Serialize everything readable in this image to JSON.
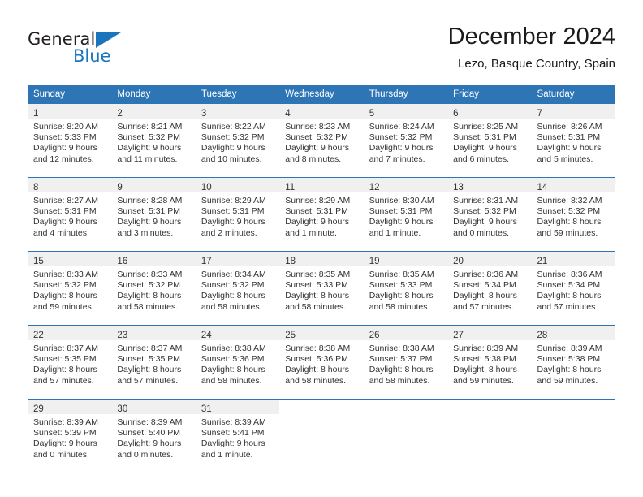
{
  "logo": {
    "word_one": "General",
    "word_two": "Blue"
  },
  "header": {
    "title": "December 2024",
    "subtitle": "Lezo, Basque Country, Spain"
  },
  "weekdays": [
    "Sunday",
    "Monday",
    "Tuesday",
    "Wednesday",
    "Thursday",
    "Friday",
    "Saturday"
  ],
  "colors": {
    "header_blue": "#2e75b6",
    "day_band_gray": "#f0f0f0",
    "logo_blue": "#1b75bc",
    "text": "#333333"
  },
  "weeks": [
    [
      {
        "num": "1",
        "l1": "Sunrise: 8:20 AM",
        "l2": "Sunset: 5:33 PM",
        "l3": "Daylight: 9 hours",
        "l4": "and 12 minutes."
      },
      {
        "num": "2",
        "l1": "Sunrise: 8:21 AM",
        "l2": "Sunset: 5:32 PM",
        "l3": "Daylight: 9 hours",
        "l4": "and 11 minutes."
      },
      {
        "num": "3",
        "l1": "Sunrise: 8:22 AM",
        "l2": "Sunset: 5:32 PM",
        "l3": "Daylight: 9 hours",
        "l4": "and 10 minutes."
      },
      {
        "num": "4",
        "l1": "Sunrise: 8:23 AM",
        "l2": "Sunset: 5:32 PM",
        "l3": "Daylight: 9 hours",
        "l4": "and 8 minutes."
      },
      {
        "num": "5",
        "l1": "Sunrise: 8:24 AM",
        "l2": "Sunset: 5:32 PM",
        "l3": "Daylight: 9 hours",
        "l4": "and 7 minutes."
      },
      {
        "num": "6",
        "l1": "Sunrise: 8:25 AM",
        "l2": "Sunset: 5:31 PM",
        "l3": "Daylight: 9 hours",
        "l4": "and 6 minutes."
      },
      {
        "num": "7",
        "l1": "Sunrise: 8:26 AM",
        "l2": "Sunset: 5:31 PM",
        "l3": "Daylight: 9 hours",
        "l4": "and 5 minutes."
      }
    ],
    [
      {
        "num": "8",
        "l1": "Sunrise: 8:27 AM",
        "l2": "Sunset: 5:31 PM",
        "l3": "Daylight: 9 hours",
        "l4": "and 4 minutes."
      },
      {
        "num": "9",
        "l1": "Sunrise: 8:28 AM",
        "l2": "Sunset: 5:31 PM",
        "l3": "Daylight: 9 hours",
        "l4": "and 3 minutes."
      },
      {
        "num": "10",
        "l1": "Sunrise: 8:29 AM",
        "l2": "Sunset: 5:31 PM",
        "l3": "Daylight: 9 hours",
        "l4": "and 2 minutes."
      },
      {
        "num": "11",
        "l1": "Sunrise: 8:29 AM",
        "l2": "Sunset: 5:31 PM",
        "l3": "Daylight: 9 hours",
        "l4": "and 1 minute."
      },
      {
        "num": "12",
        "l1": "Sunrise: 8:30 AM",
        "l2": "Sunset: 5:31 PM",
        "l3": "Daylight: 9 hours",
        "l4": "and 1 minute."
      },
      {
        "num": "13",
        "l1": "Sunrise: 8:31 AM",
        "l2": "Sunset: 5:32 PM",
        "l3": "Daylight: 9 hours",
        "l4": "and 0 minutes."
      },
      {
        "num": "14",
        "l1": "Sunrise: 8:32 AM",
        "l2": "Sunset: 5:32 PM",
        "l3": "Daylight: 8 hours",
        "l4": "and 59 minutes."
      }
    ],
    [
      {
        "num": "15",
        "l1": "Sunrise: 8:33 AM",
        "l2": "Sunset: 5:32 PM",
        "l3": "Daylight: 8 hours",
        "l4": "and 59 minutes."
      },
      {
        "num": "16",
        "l1": "Sunrise: 8:33 AM",
        "l2": "Sunset: 5:32 PM",
        "l3": "Daylight: 8 hours",
        "l4": "and 58 minutes."
      },
      {
        "num": "17",
        "l1": "Sunrise: 8:34 AM",
        "l2": "Sunset: 5:32 PM",
        "l3": "Daylight: 8 hours",
        "l4": "and 58 minutes."
      },
      {
        "num": "18",
        "l1": "Sunrise: 8:35 AM",
        "l2": "Sunset: 5:33 PM",
        "l3": "Daylight: 8 hours",
        "l4": "and 58 minutes."
      },
      {
        "num": "19",
        "l1": "Sunrise: 8:35 AM",
        "l2": "Sunset: 5:33 PM",
        "l3": "Daylight: 8 hours",
        "l4": "and 58 minutes."
      },
      {
        "num": "20",
        "l1": "Sunrise: 8:36 AM",
        "l2": "Sunset: 5:34 PM",
        "l3": "Daylight: 8 hours",
        "l4": "and 57 minutes."
      },
      {
        "num": "21",
        "l1": "Sunrise: 8:36 AM",
        "l2": "Sunset: 5:34 PM",
        "l3": "Daylight: 8 hours",
        "l4": "and 57 minutes."
      }
    ],
    [
      {
        "num": "22",
        "l1": "Sunrise: 8:37 AM",
        "l2": "Sunset: 5:35 PM",
        "l3": "Daylight: 8 hours",
        "l4": "and 57 minutes."
      },
      {
        "num": "23",
        "l1": "Sunrise: 8:37 AM",
        "l2": "Sunset: 5:35 PM",
        "l3": "Daylight: 8 hours",
        "l4": "and 57 minutes."
      },
      {
        "num": "24",
        "l1": "Sunrise: 8:38 AM",
        "l2": "Sunset: 5:36 PM",
        "l3": "Daylight: 8 hours",
        "l4": "and 58 minutes."
      },
      {
        "num": "25",
        "l1": "Sunrise: 8:38 AM",
        "l2": "Sunset: 5:36 PM",
        "l3": "Daylight: 8 hours",
        "l4": "and 58 minutes."
      },
      {
        "num": "26",
        "l1": "Sunrise: 8:38 AM",
        "l2": "Sunset: 5:37 PM",
        "l3": "Daylight: 8 hours",
        "l4": "and 58 minutes."
      },
      {
        "num": "27",
        "l1": "Sunrise: 8:39 AM",
        "l2": "Sunset: 5:38 PM",
        "l3": "Daylight: 8 hours",
        "l4": "and 59 minutes."
      },
      {
        "num": "28",
        "l1": "Sunrise: 8:39 AM",
        "l2": "Sunset: 5:38 PM",
        "l3": "Daylight: 8 hours",
        "l4": "and 59 minutes."
      }
    ],
    [
      {
        "num": "29",
        "l1": "Sunrise: 8:39 AM",
        "l2": "Sunset: 5:39 PM",
        "l3": "Daylight: 9 hours",
        "l4": "and 0 minutes."
      },
      {
        "num": "30",
        "l1": "Sunrise: 8:39 AM",
        "l2": "Sunset: 5:40 PM",
        "l3": "Daylight: 9 hours",
        "l4": "and 0 minutes."
      },
      {
        "num": "31",
        "l1": "Sunrise: 8:39 AM",
        "l2": "Sunset: 5:41 PM",
        "l3": "Daylight: 9 hours",
        "l4": "and 1 minute."
      },
      {
        "num": "",
        "l1": "",
        "l2": "",
        "l3": "",
        "l4": ""
      },
      {
        "num": "",
        "l1": "",
        "l2": "",
        "l3": "",
        "l4": ""
      },
      {
        "num": "",
        "l1": "",
        "l2": "",
        "l3": "",
        "l4": ""
      },
      {
        "num": "",
        "l1": "",
        "l2": "",
        "l3": "",
        "l4": ""
      }
    ]
  ]
}
